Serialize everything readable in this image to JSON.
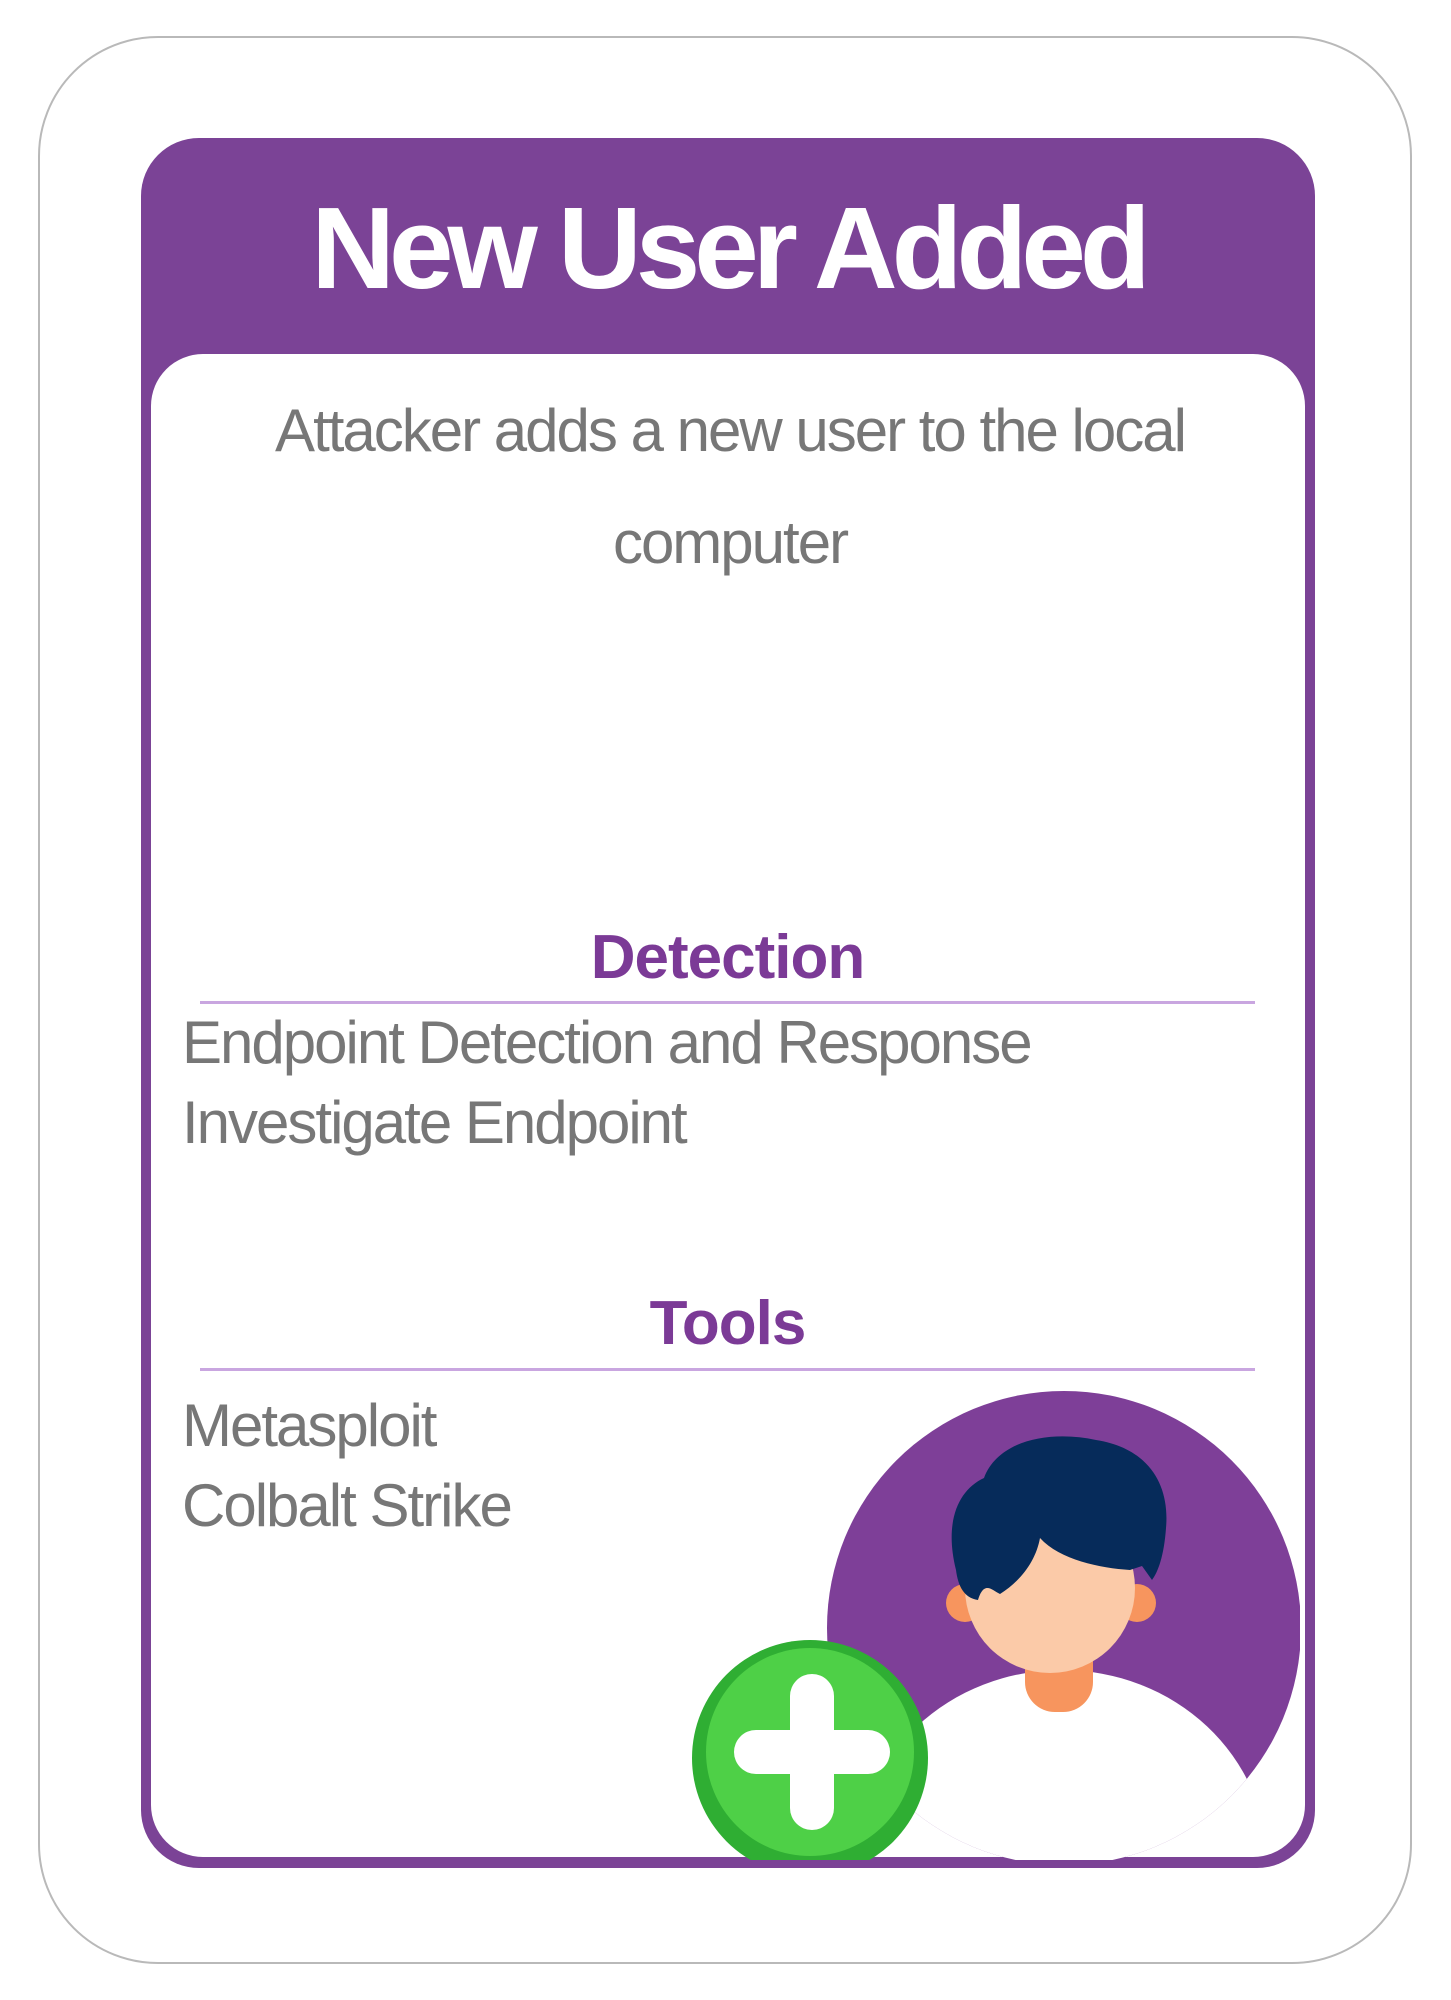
{
  "card": {
    "title": "New User Added",
    "description": "Attacker adds a new user to the local computer",
    "detection": {
      "heading": "Detection",
      "items": [
        "Endpoint Detection and Response",
        "Investigate Endpoint"
      ]
    },
    "tools": {
      "heading": "Tools",
      "items": [
        "Metasploit",
        "Colbalt Strike"
      ]
    },
    "illustration": {
      "icon": "add-user-icon",
      "circle_color": "#7e3f98",
      "plus_color": "#3fc53c",
      "hair_color": "#062b5a",
      "skin_color": "#fbcaa8",
      "neck_color": "#f7955e"
    }
  },
  "colors": {
    "frame": "#7b4396",
    "heading": "#7b3a96",
    "body_text": "#777777",
    "rule": "#c9a6e0"
  }
}
